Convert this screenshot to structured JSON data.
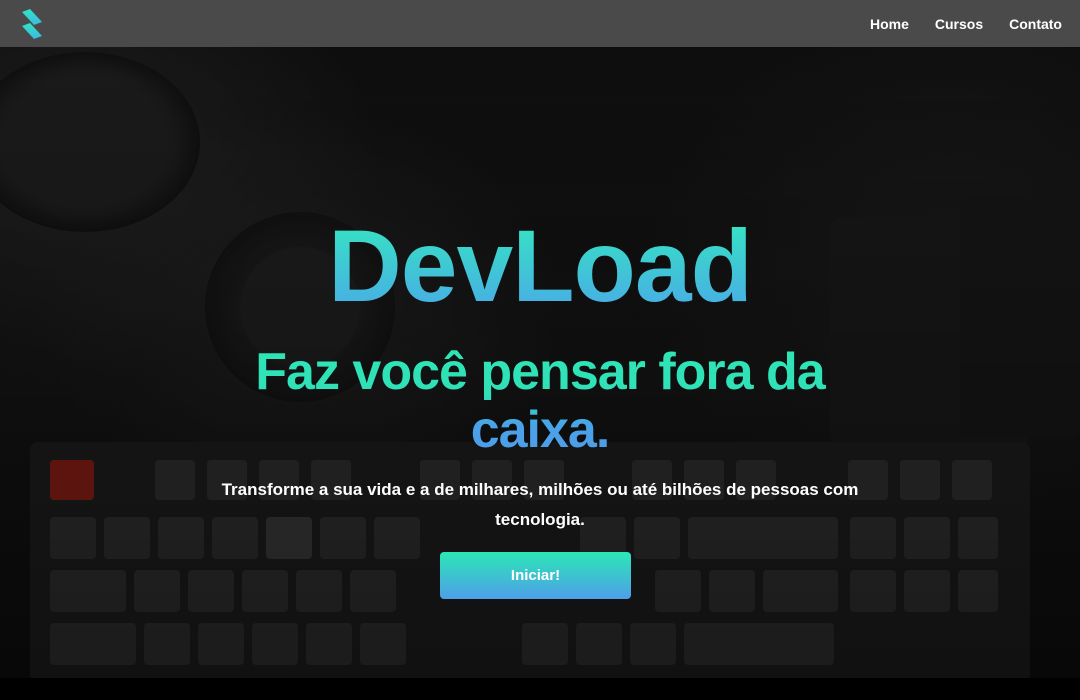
{
  "navbar": {
    "logo_icon": "devload-logo-icon",
    "links": [
      {
        "label": "Home"
      },
      {
        "label": "Cursos"
      },
      {
        "label": "Contato"
      }
    ]
  },
  "hero": {
    "title": "DevLoad",
    "tagline": "Faz você pensar fora da caixa.",
    "subtitle": "Transforme a sua vida e a de milhares, milhões ou até bilhões de pessoas com tecnologia.",
    "cta_label": "Iniciar!",
    "background_image": "dark-keyboard-photo"
  },
  "colors": {
    "navbar_bg": "#4a4a4a",
    "gradient_start": "#2ee6b4",
    "gradient_end": "#4f9fe9",
    "text": "#ffffff"
  }
}
